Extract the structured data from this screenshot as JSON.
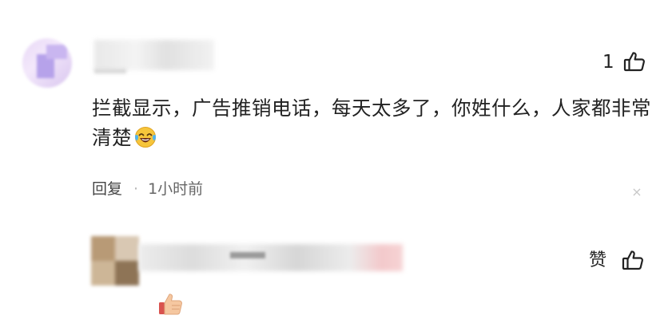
{
  "comment1": {
    "like_count": "1",
    "text": "拦截显示，广告推销电话，每天太多了，你姓什么，人家都非常清楚",
    "reply_label": "回复",
    "separator": "·",
    "time": "1小时前",
    "close_glyph": "×",
    "emoji_icon": "laughing-tears-emoji"
  },
  "comment2": {
    "like_label": "赞",
    "emoji_icon": "thumbs-up-emoji"
  },
  "icons": {
    "like": "thumbs-up-outline-icon",
    "close": "close-icon"
  }
}
